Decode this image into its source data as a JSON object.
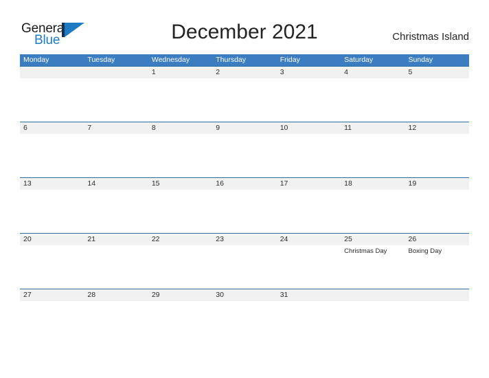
{
  "brand": {
    "name_line1": "General",
    "name_line2": "Blue",
    "mark": "flag-triangle-icon",
    "color_dark": "#14314d",
    "color_blue": "#1f7ac4"
  },
  "header": {
    "title": "December 2021",
    "location": "Christmas Island"
  },
  "theme": {
    "header_blue": "#3b7dc0",
    "rule_blue": "#2e6da4",
    "date_band_gray": "#f1f1f1",
    "text_dark": "#2b2b2b"
  },
  "calendar": {
    "weekday_headers": [
      "Monday",
      "Tuesday",
      "Wednesday",
      "Thursday",
      "Friday",
      "Saturday",
      "Sunday"
    ],
    "weeks": [
      {
        "dates": [
          "",
          "",
          "1",
          "2",
          "3",
          "4",
          "5"
        ],
        "events": [
          "",
          "",
          "",
          "",
          "",
          "",
          ""
        ]
      },
      {
        "dates": [
          "6",
          "7",
          "8",
          "9",
          "10",
          "11",
          "12"
        ],
        "events": [
          "",
          "",
          "",
          "",
          "",
          "",
          ""
        ]
      },
      {
        "dates": [
          "13",
          "14",
          "15",
          "16",
          "17",
          "18",
          "19"
        ],
        "events": [
          "",
          "",
          "",
          "",
          "",
          "",
          ""
        ]
      },
      {
        "dates": [
          "20",
          "21",
          "22",
          "23",
          "24",
          "25",
          "26"
        ],
        "events": [
          "",
          "",
          "",
          "",
          "",
          "Christmas Day",
          "Boxing Day"
        ]
      },
      {
        "dates": [
          "27",
          "28",
          "29",
          "30",
          "31",
          "",
          ""
        ],
        "events": [
          "",
          "",
          "",
          "",
          "",
          "",
          ""
        ]
      }
    ]
  }
}
